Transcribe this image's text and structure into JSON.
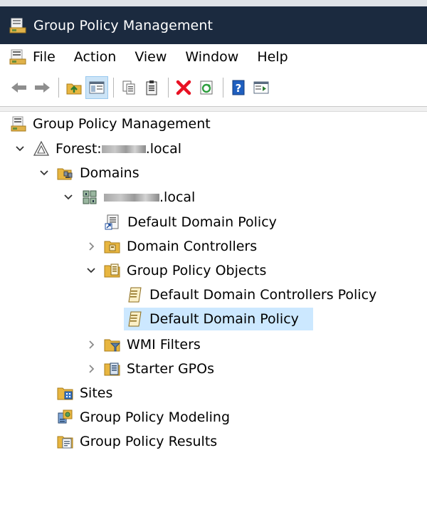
{
  "window": {
    "title": "Group Policy Management",
    "icon": "gpmc-console-icon"
  },
  "menubar": {
    "items": [
      "File",
      "Action",
      "View",
      "Window",
      "Help"
    ]
  },
  "toolbar": {
    "buttons": [
      "back-arrow-icon",
      "forward-arrow-icon",
      "up-folder-icon",
      "show-hide-tree-icon",
      "copy-icon",
      "paste-icon",
      "delete-icon",
      "refresh-icon",
      "help-icon",
      "properties-icon"
    ],
    "pressed": "show-hide-tree-icon"
  },
  "tree": {
    "root": "Group Policy Management",
    "forest_prefix": "Forest: ",
    "forest_suffix": ".local",
    "domains": "Domains",
    "domain_suffix": ".local",
    "default_domain_policy_link": "Default Domain Policy",
    "domain_controllers": "Domain Controllers",
    "gpo_container": "Group Policy Objects",
    "gpo_ddcp": "Default Domain Controllers Policy",
    "gpo_ddp": "Default Domain Policy",
    "wmi_filters": "WMI Filters",
    "starter_gpos": "Starter GPOs",
    "sites": "Sites",
    "modeling": "Group Policy Modeling",
    "results": "Group Policy Results",
    "selected": "Default Domain Policy"
  },
  "colors": {
    "titlebar": "#1b2a3f",
    "selection": "#cce8ff",
    "delete_red": "#e81123"
  }
}
